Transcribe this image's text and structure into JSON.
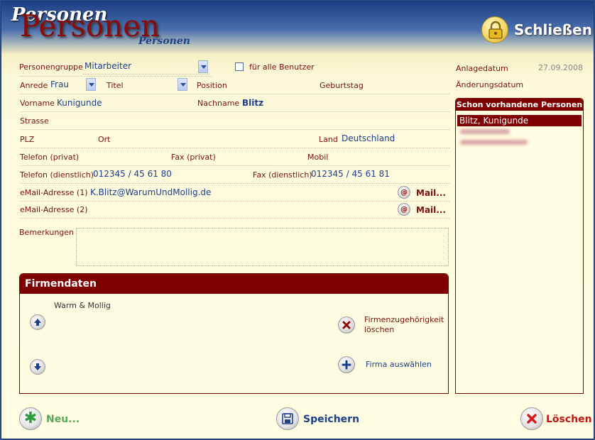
{
  "header": {
    "title_small": "Personen",
    "title_big": "Personen",
    "title_shadow": "Personen",
    "close_label": "Schließen"
  },
  "form": {
    "personengruppe": {
      "label": "Personengruppe",
      "value": "Mitarbeiter"
    },
    "fuer_alle_benutzer": {
      "label": "für alle Benutzer",
      "checked": false
    },
    "anrede": {
      "label": "Anrede",
      "value": "Frau"
    },
    "titel": {
      "label": "Titel",
      "value": ""
    },
    "position": {
      "label": "Position",
      "value": ""
    },
    "geburtstag": {
      "label": "Geburtstag",
      "value": ""
    },
    "vorname": {
      "label": "Vorname",
      "value": "Kunigunde"
    },
    "nachname": {
      "label": "Nachname",
      "value": "Blitz"
    },
    "strasse": {
      "label": "Strasse",
      "value": ""
    },
    "plz": {
      "label": "PLZ",
      "value": ""
    },
    "ort": {
      "label": "Ort",
      "value": ""
    },
    "land": {
      "label": "Land",
      "value": "Deutschland"
    },
    "telefon_privat": {
      "label": "Telefon (privat)",
      "value": ""
    },
    "fax_privat": {
      "label": "Fax (privat)",
      "value": ""
    },
    "mobil": {
      "label": "Mobil",
      "value": ""
    },
    "telefon_dienstlich": {
      "label": "Telefon (dienstlich)",
      "value": "012345 / 45 61 80"
    },
    "fax_dienstlich": {
      "label": "Fax (dienstlich)",
      "value": "012345 / 45 61 81"
    },
    "email1": {
      "label": "eMail-Adresse (1)",
      "value": "K.Blitz@WarumUndMollig.de"
    },
    "email2": {
      "label": "eMail-Adresse (2)",
      "value": ""
    },
    "mail_button_label": "Mail...",
    "bemerkungen": {
      "label": "Bemerkungen",
      "value": ""
    }
  },
  "meta": {
    "anlagedatum_label": "Anlagedatum",
    "anlagedatum_value": "27.09.2008",
    "aenderungsdatum_label": "Änderungsdatum",
    "aenderungsdatum_value": ""
  },
  "existing_persons": {
    "title": "Schon vorhandene Personen",
    "items": [
      "Blitz, Kunigunde"
    ]
  },
  "firmendaten": {
    "title": "Firmendaten",
    "firm": "Warm & Mollig",
    "delete_label": "Firmenzugehörigkeit löschen",
    "select_label": "Firma auswählen"
  },
  "footer": {
    "new_label": "Neu...",
    "save_label": "Speichern",
    "delete_label": "Löschen"
  },
  "colors": {
    "label": "#7a1010",
    "value": "#1e3f8a",
    "accent": "#7e0000",
    "background": "#fffde2"
  }
}
